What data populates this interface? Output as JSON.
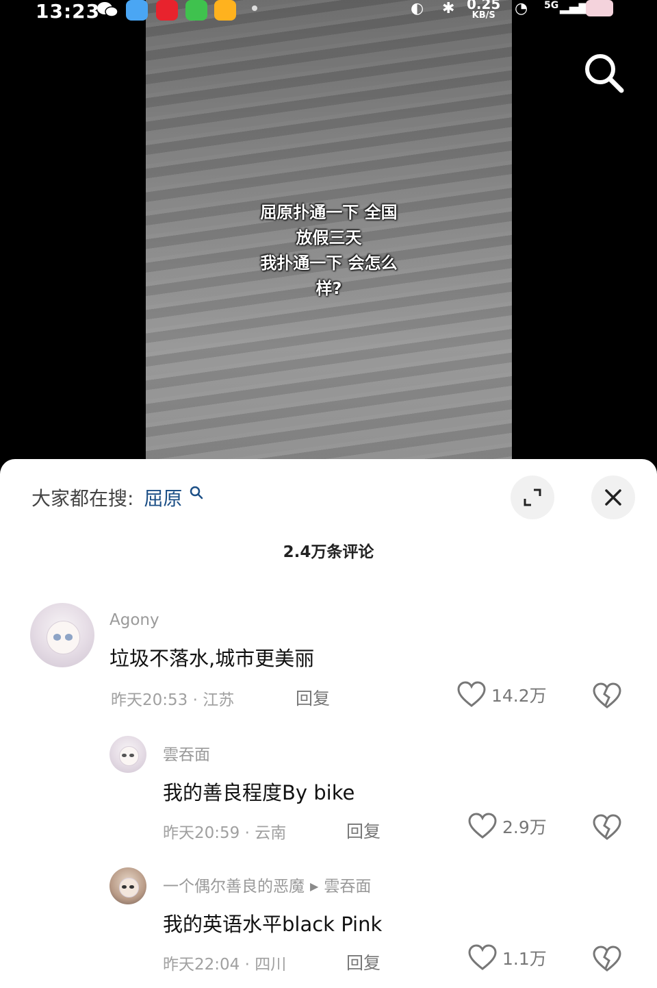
{
  "status_bar": {
    "time": "13:23",
    "net_speed_value": "0.25",
    "net_speed_unit": "KB/S",
    "network": "5G"
  },
  "video": {
    "caption_lines": [
      "屈原扑通一下 全国",
      "放假三天",
      "我扑通一下 会怎么",
      "样?"
    ]
  },
  "panel": {
    "hot_search_label": "大家都在搜:",
    "hot_search_keyword": "屈原",
    "comment_count": "2.4万条评论"
  },
  "comments": [
    {
      "username": "Agony",
      "text": "垃圾不落水,城市更美丽",
      "meta": "昨天20:53 · 江苏",
      "reply_label": "回复",
      "likes": "14.2万"
    },
    {
      "username": "雲吞面",
      "text": "我的善良程度By bike",
      "meta": "昨天20:59 · 云南",
      "reply_label": "回复",
      "likes": "2.9万"
    },
    {
      "username": "一个偶尔善良的恶魔",
      "reply_to": "雲吞面",
      "text": "我的英语水平black Pink",
      "meta": "昨天22:04 · 四川",
      "reply_label": "回复",
      "likes": "1.1万"
    }
  ],
  "colors": {
    "keyword": "#1c4f86",
    "panel_bg": "#ffffff",
    "muted_text": "#9a9a9a"
  },
  "icons": [
    "search-icon",
    "expand-icon",
    "close-icon",
    "heart-icon",
    "broken-heart-icon"
  ]
}
